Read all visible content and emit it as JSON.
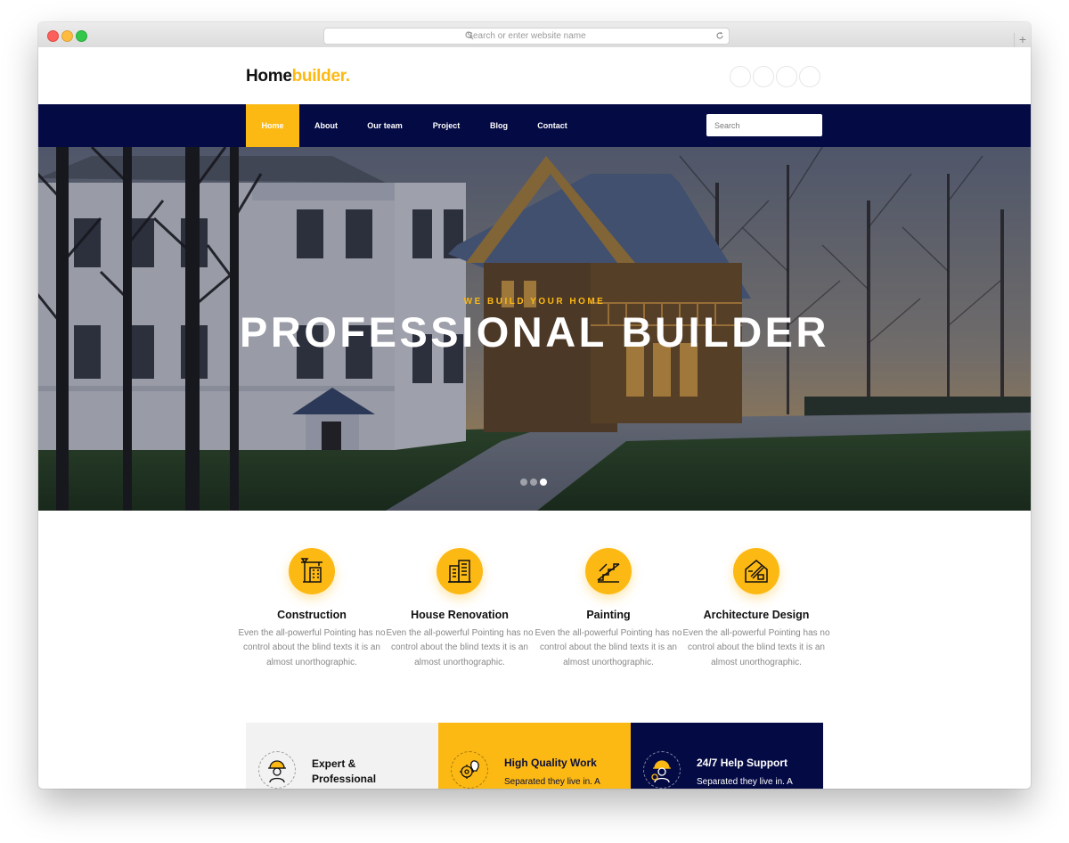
{
  "browser": {
    "url_placeholder": "Search or enter website name",
    "new_tab": "+"
  },
  "brand": {
    "part1": "Home",
    "part2": "builder."
  },
  "nav": {
    "items": [
      "Home",
      "About",
      "Our team",
      "Project",
      "Blog",
      "Contact"
    ],
    "active": "Home",
    "search_placeholder": "Search"
  },
  "hero": {
    "eyebrow": "WE BUILD YOUR HOME",
    "headline": "PROFESSIONAL BUILDER",
    "slide_count": 3,
    "active_slide": 3
  },
  "services": [
    {
      "icon": "crane-building-icon",
      "title": "Construction",
      "desc": "Even the all-powerful Pointing has no control about the blind texts it is an almost unorthographic."
    },
    {
      "icon": "buildings-icon",
      "title": "House Renovation",
      "desc": "Even the all-powerful Pointing has no control about the blind texts it is an almost unorthographic."
    },
    {
      "icon": "stairs-icon",
      "title": "Painting",
      "desc": "Even the all-powerful Pointing has no control about the blind texts it is an almost unorthographic."
    },
    {
      "icon": "blueprint-icon",
      "title": "Architecture Design",
      "desc": "Even the all-powerful Pointing has no control about the blind texts it is an almost unorthographic."
    }
  ],
  "features": [
    {
      "icon": "worker-helmet-icon",
      "title": "Expert & Professional",
      "desc": "",
      "bg": "#f2f2f2",
      "fg": "#111111"
    },
    {
      "icon": "gear-bulb-icon",
      "title": "High Quality Work",
      "desc": "Separated they live in. A",
      "bg": "#fdb913",
      "fg": "#0a0f3c"
    },
    {
      "icon": "support-worker-icon",
      "title": "24/7 Help Support",
      "desc": "Separated they live in. A",
      "bg": "#040a44",
      "fg": "#ffffff"
    }
  ],
  "colors": {
    "accent": "#fdb913",
    "navy": "#040a44"
  }
}
